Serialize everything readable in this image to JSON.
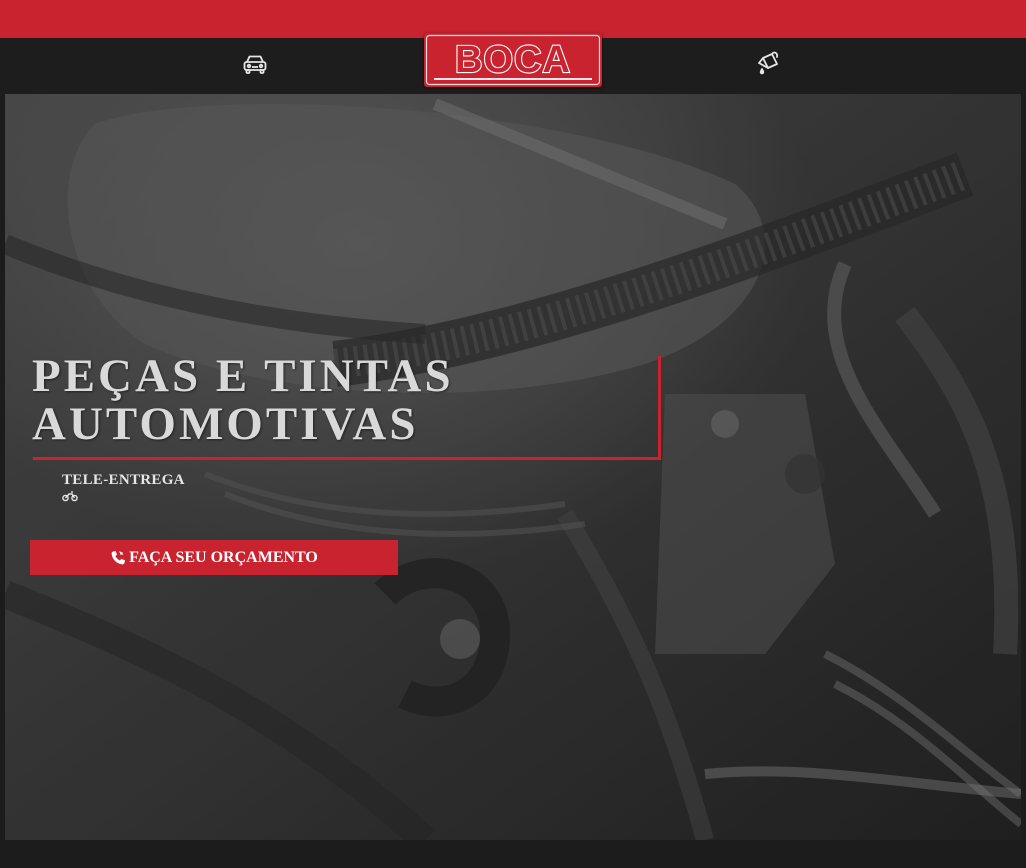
{
  "brand": {
    "logo_text": "BOCA"
  },
  "nav": {
    "left_icon": "car-icon",
    "right_icon": "paint-bucket-icon"
  },
  "hero": {
    "headline_line1": "PEÇAS E TINTAS",
    "headline_line2": "AUTOMOTIVAS",
    "tele_label": "TELE-ENTREGA",
    "tele_icon": "motorcycle-icon",
    "cta_label": "FAÇA SEU ORÇAMENTO",
    "cta_icon": "phone-icon"
  },
  "colors": {
    "accent": "#c8232f",
    "navbar": "#1d1d1d",
    "text": "#d9d9d9"
  }
}
